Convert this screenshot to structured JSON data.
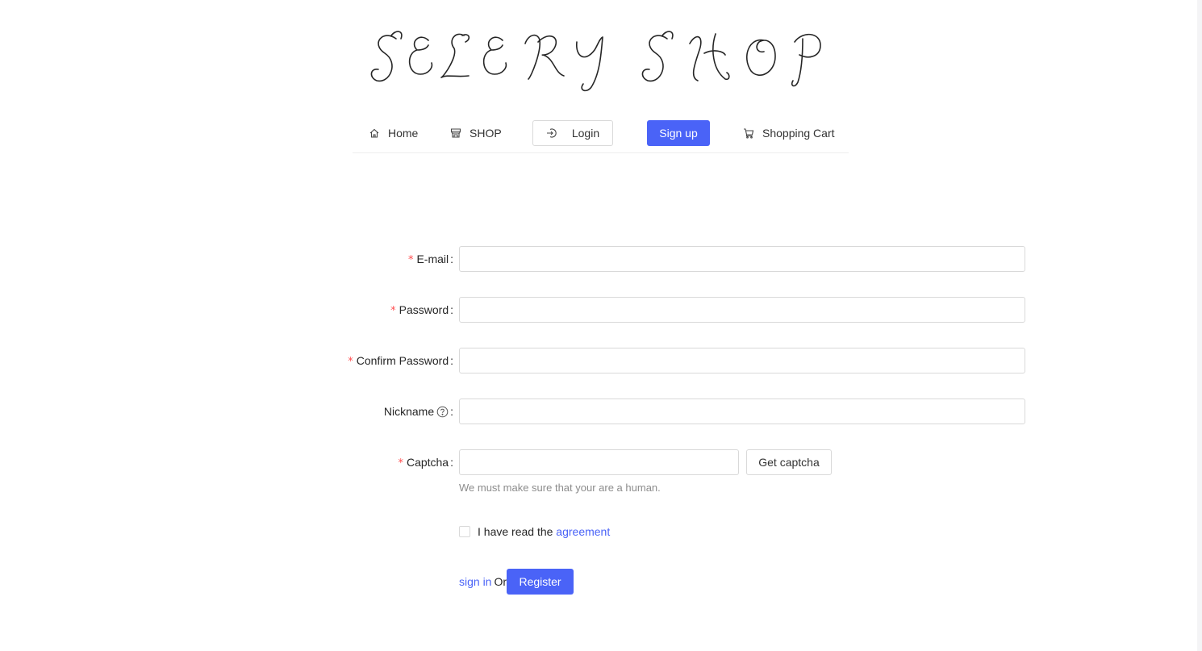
{
  "logo": {
    "text": "SELERY SHOP"
  },
  "nav": {
    "home": "Home",
    "shop": "SHOP",
    "login": "Login",
    "signup": "Sign up",
    "cart": "Shopping Cart"
  },
  "form": {
    "email_label": "E-mail",
    "password_label": "Password",
    "confirm_label": "Confirm Password",
    "nickname_label": "Nickname",
    "captcha_label": "Captcha",
    "required_mark": "*",
    "colon": ":",
    "email_value": "",
    "password_value": "",
    "confirm_value": "",
    "nickname_value": "",
    "captcha_value": "",
    "get_captcha": "Get captcha",
    "captcha_hint": "We must make sure that your are a human.",
    "agree_prefix": "I have read the ",
    "agree_link": "agreement",
    "sign_in_link": "sign in",
    "or": "Or",
    "register": "Register"
  },
  "colors": {
    "accent": "#4a63f7",
    "required": "#ff4d4f",
    "border": "#d9d9d9",
    "hint": "#8c8c8c"
  }
}
